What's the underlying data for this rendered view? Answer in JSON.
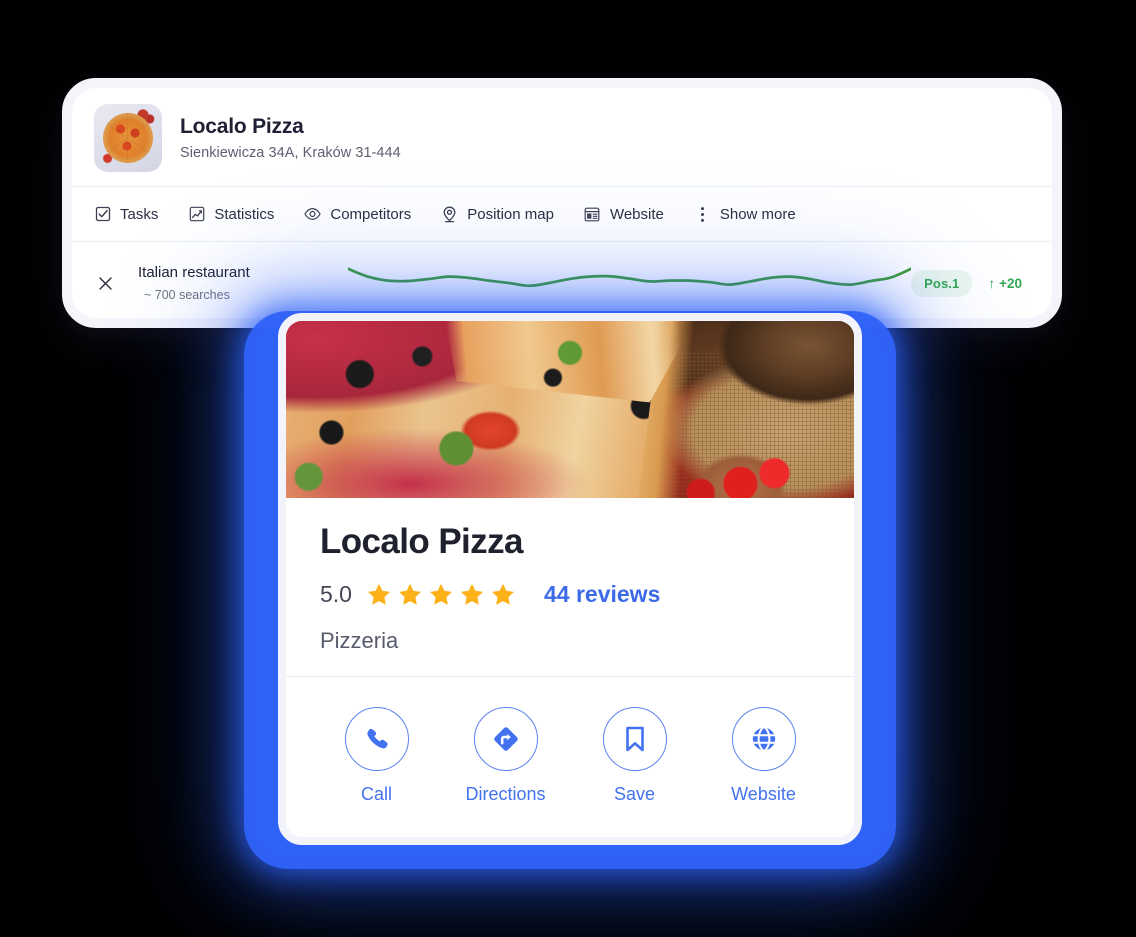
{
  "dashboard": {
    "business": {
      "name": "Localo Pizza",
      "address": "Sienkiewicza 34A, Kraków 31-444",
      "thumb_icon": "pizza-thumbnail"
    },
    "tabs": [
      {
        "label": "Tasks",
        "icon": "checkbox-checked-icon"
      },
      {
        "label": "Statistics",
        "icon": "chart-bars-icon"
      },
      {
        "label": "Competitors",
        "icon": "eye-icon"
      },
      {
        "label": "Position map",
        "icon": "map-pin-icon"
      },
      {
        "label": "Website",
        "icon": "browser-window-icon"
      },
      {
        "label": "Show more",
        "icon": "three-dots-vertical-icon"
      }
    ],
    "keyword_row": {
      "close_icon": "close-icon",
      "keyword": "Italian restaurant",
      "searches": "~ 700 searches",
      "position_badge": "Pos.1",
      "delta_arrow": "↑",
      "delta_value": "+20",
      "badge_bg_color": "#eaf6ee",
      "accent_green": "#34a853"
    },
    "chart_data": {
      "type": "line",
      "title": "",
      "xlabel": "",
      "ylabel": "",
      "grid": false,
      "legend": null,
      "line_color": "#3f9e34",
      "ylim": [
        0,
        10
      ],
      "x": [
        0,
        1,
        2,
        3,
        4,
        5,
        6,
        7,
        8,
        9,
        10,
        11,
        12,
        13,
        14,
        15,
        16,
        17,
        18,
        19,
        20,
        21,
        22,
        23,
        24,
        25,
        26,
        27,
        28
      ],
      "values": [
        8.6,
        6.6,
        5.6,
        5.5,
        6.0,
        6.6,
        6.3,
        5.6,
        5.0,
        4.3,
        5.0,
        6.0,
        6.6,
        6.7,
        6.1,
        5.4,
        5.6,
        5.6,
        5.2,
        4.6,
        5.4,
        6.3,
        6.6,
        6.0,
        5.0,
        4.6,
        5.5,
        6.4,
        8.6
      ]
    }
  },
  "gmb_card": {
    "photo_alt": "pizza-photo",
    "title": "Localo Pizza",
    "rating": "5.0",
    "stars_filled": 5,
    "star_color": "#fbb117",
    "reviews": "44 reviews",
    "category": "Pizzeria",
    "link_color": "#4272ef",
    "actions": [
      {
        "label": "Call",
        "icon": "phone-icon"
      },
      {
        "label": "Directions",
        "icon": "directions-diamond-icon"
      },
      {
        "label": "Save",
        "icon": "bookmark-icon"
      },
      {
        "label": "Website",
        "icon": "globe-icon"
      }
    ]
  }
}
